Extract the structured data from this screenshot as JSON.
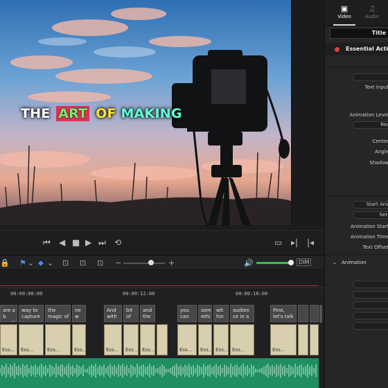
{
  "viewer": {
    "title_words": [
      "THE",
      "ART",
      "OF",
      "MAKING"
    ]
  },
  "inspector": {
    "tabs": [
      {
        "label": "Video",
        "icon": "video-icon",
        "active": true
      },
      {
        "label": "Audio",
        "icon": "music-note-icon",
        "active": false
      }
    ],
    "title_tab": "Title",
    "effect_name": "Essential Active",
    "text_input_label": "Text Input",
    "animation_level_label": "Animation Level",
    "reset_label": "Rese",
    "center_label": "Center",
    "angle_label": "Angle",
    "shadow_label": "Shadow",
    "start_anim_label": "Start Anim",
    "set_label": "Set A",
    "animation_start_label": "Animation Start",
    "animation_time_label": "Animation Time",
    "text_offset_label": "Text Offset",
    "animation_section": "Animation",
    "d_button": "D"
  },
  "toolbar": {
    "dim_label": "DIM"
  },
  "timeline": {
    "timecodes": [
      "00:00:08:00",
      "00:00:12:00",
      "00:00:16:00"
    ],
    "video_clips_top": [
      {
        "text": "are a b eauti"
      },
      {
        "text": "way to capture"
      },
      {
        "text": "the magic of"
      },
      {
        "text": "ne w"
      },
      {
        "text": "And with"
      },
      {
        "text": "bit of"
      },
      {
        "text": "and the"
      },
      {
        "text": "you can"
      },
      {
        "text": "som ethi"
      },
      {
        "text": "wit ​hin a"
      },
      {
        "text": "audien ce in a"
      },
      {
        "text": "First, let's talk"
      }
    ],
    "clip_label": "Ess..."
  },
  "colors": {
    "accent_green": "#35c24a",
    "audio_track": "#1f8f5f",
    "title_pink": "#e0305a"
  }
}
